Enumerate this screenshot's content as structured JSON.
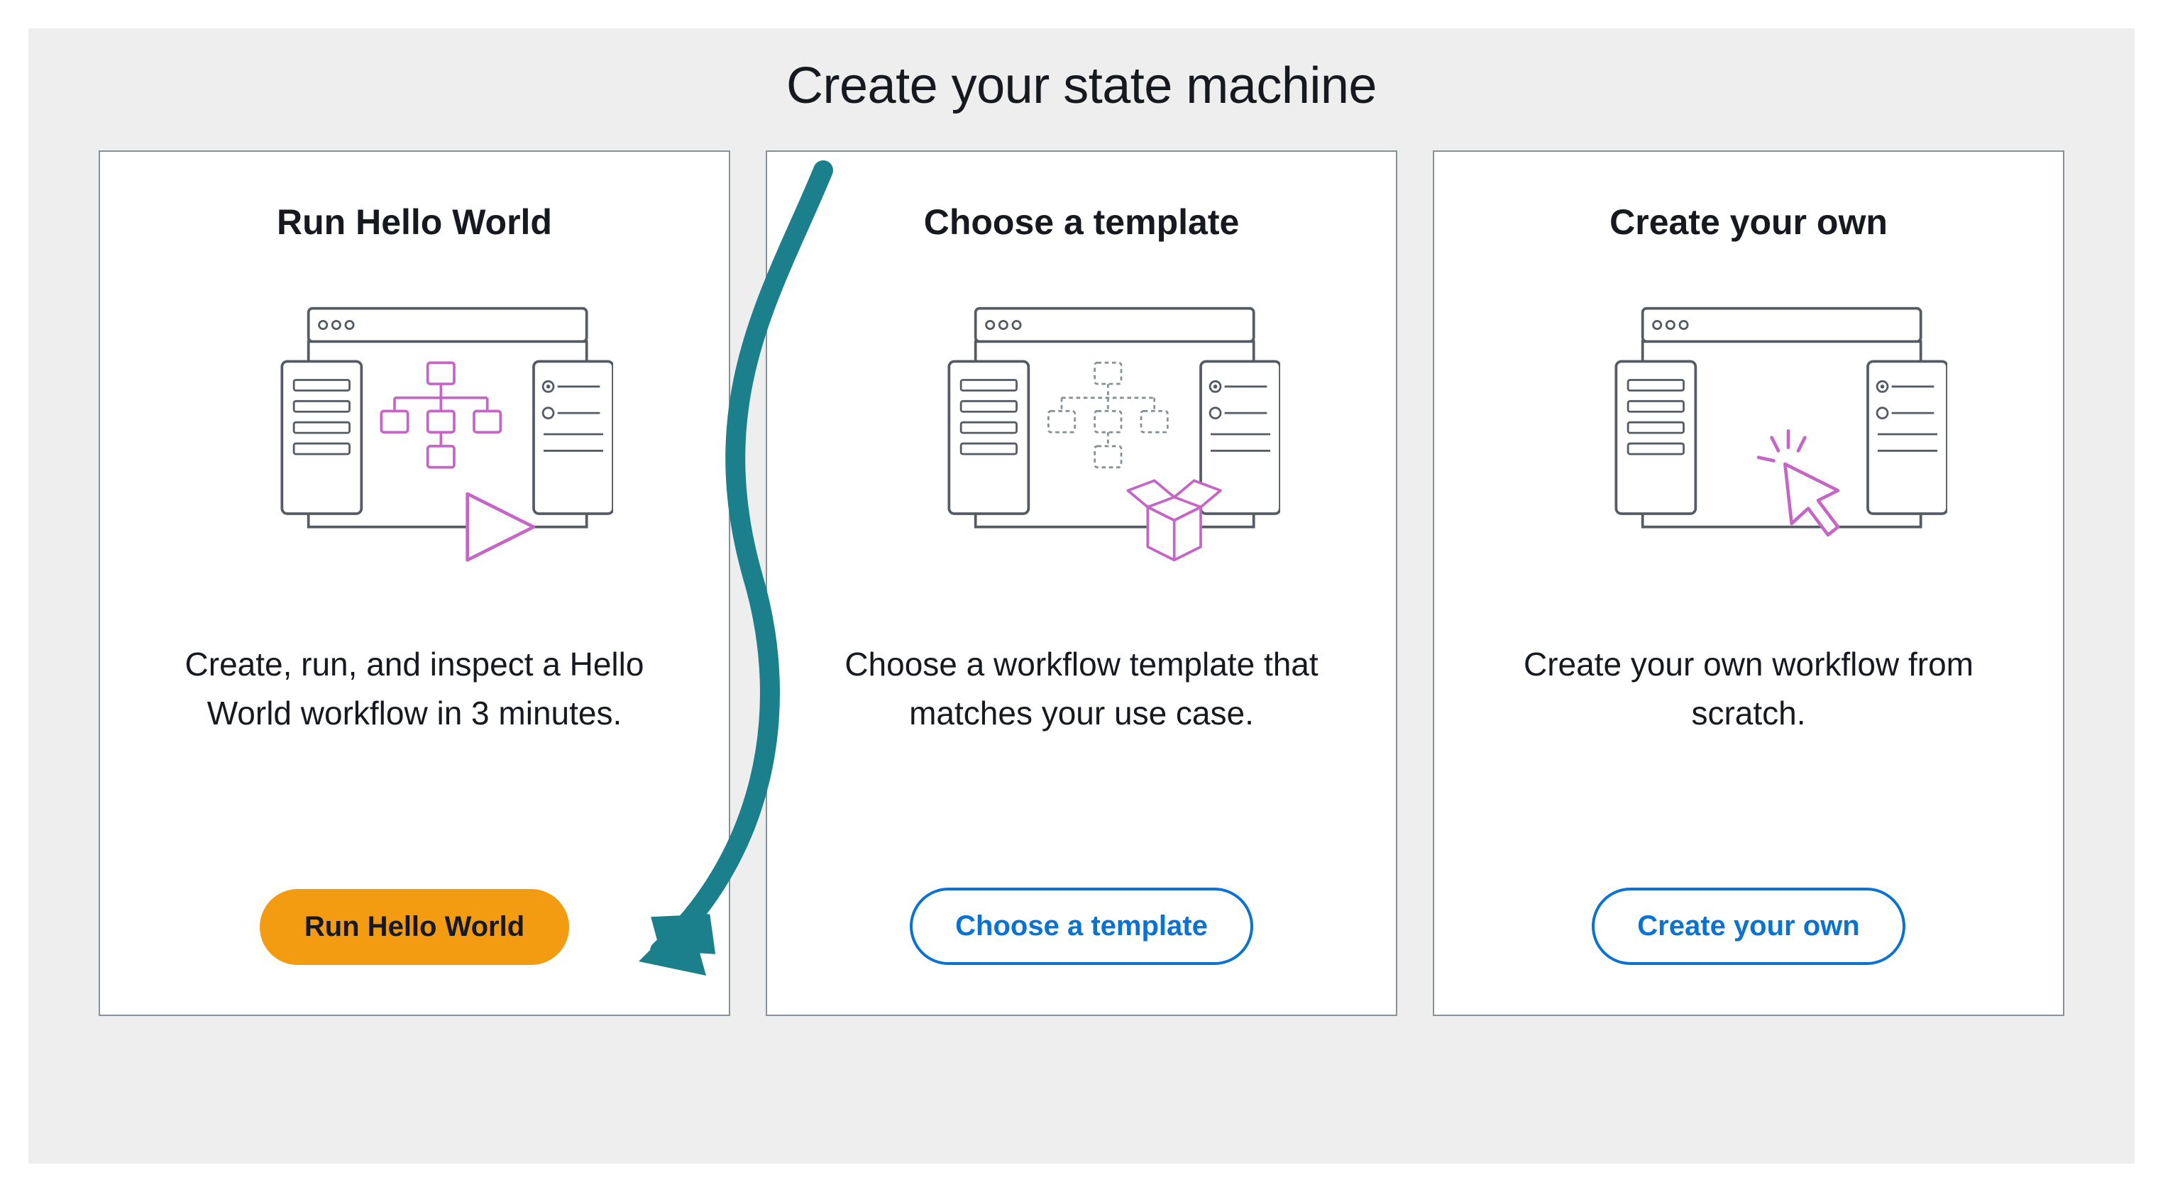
{
  "page_title": "Create your state machine",
  "cards": [
    {
      "title": "Run Hello World",
      "description": "Create, run, and inspect a Hello World workflow in 3 minutes.",
      "button_label": "Run Hello World",
      "button_style": "primary"
    },
    {
      "title": "Choose a template",
      "description": "Choose a workflow template that matches your use case.",
      "button_label": "Choose a template",
      "button_style": "secondary"
    },
    {
      "title": "Create your own",
      "description": "Create your own workflow from scratch.",
      "button_label": "Create your own",
      "button_style": "secondary"
    }
  ],
  "colors": {
    "accent_orange": "#f39c12",
    "accent_blue": "#0972d3",
    "accent_magenta": "#c566c7",
    "accent_teal": "#1b7f8c",
    "border_gray": "#879196",
    "text_dark": "#16191f",
    "bg_gray": "#eeeeee"
  }
}
